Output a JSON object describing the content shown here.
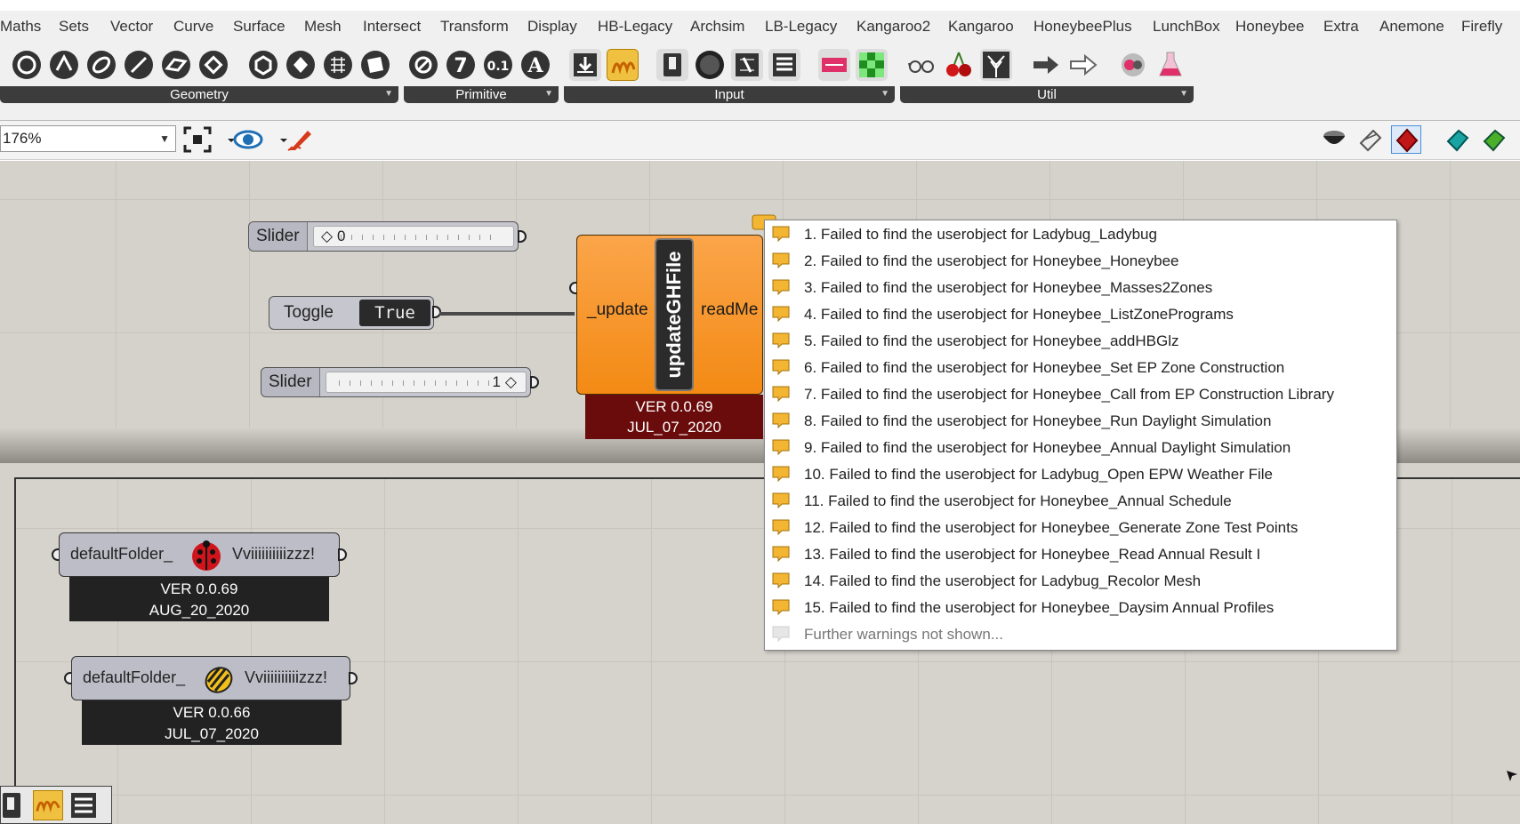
{
  "menu": [
    "Maths",
    "Sets",
    "Vector",
    "Curve",
    "Surface",
    "Mesh",
    "Intersect",
    "Transform",
    "Display",
    "HB-Legacy",
    "Archsim",
    "LB-Legacy",
    "Kangaroo2",
    "Kangaroo",
    "HoneybeePlus",
    "LunchBox",
    "Honeybee",
    "Extra",
    "Anemone",
    "Firefly"
  ],
  "ribbon": {
    "groups": [
      "Geometry",
      "Primitive",
      "Input",
      "Util"
    ]
  },
  "canvas_toolbar": {
    "zoom": "176%"
  },
  "components": {
    "slider_top": {
      "name": "Slider",
      "value": "0"
    },
    "toggle": {
      "name": "Toggle",
      "value": "True"
    },
    "slider_bottom": {
      "name": "Slider",
      "value": "1"
    },
    "update": {
      "input": "_update",
      "title": "updateGHFile",
      "output": "readMe",
      "version": "VER 0.0.69",
      "date": "JUL_07_2020"
    },
    "ladybug": {
      "input": "defaultFolder_",
      "output": "Vviiiiiiiiiizzz!",
      "version": "VER 0.0.69",
      "date": "AUG_20_2020"
    },
    "honeybee": {
      "input": "defaultFolder_",
      "output": "Vviiiiiiiiiizzz!",
      "version": "VER 0.0.66",
      "date": "JUL_07_2020"
    }
  },
  "warnings": {
    "items": [
      "1. Failed to find the userobject for Ladybug_Ladybug",
      "2. Failed to find the userobject for Honeybee_Honeybee",
      "3. Failed to find the userobject for Honeybee_Masses2Zones",
      "4. Failed to find the userobject for Honeybee_ListZonePrograms",
      "5. Failed to find the userobject for Honeybee_addHBGlz",
      "6. Failed to find the userobject for Honeybee_Set EP Zone Construction",
      "7. Failed to find the userobject for Honeybee_Call from EP Construction Library",
      "8. Failed to find the userobject for Honeybee_Run Daylight Simulation",
      "9. Failed to find the userobject for Honeybee_Annual Daylight Simulation",
      "10. Failed to find the userobject for Ladybug_Open EPW Weather File",
      "11. Failed to find the userobject for Honeybee_Annual Schedule",
      "12. Failed to find the userobject for Honeybee_Generate Zone Test Points",
      "13. Failed to find the userobject for Honeybee_Read Annual Result I",
      "14. Failed to find the userobject for Ladybug_Recolor Mesh",
      "15. Failed to find the userobject for Honeybee_Daysim Annual Profiles"
    ],
    "more": "Further warnings not shown..."
  },
  "colors": {
    "warning": "#f2b632",
    "component": "#f7931e",
    "version_bar": "#6b0c0c"
  }
}
